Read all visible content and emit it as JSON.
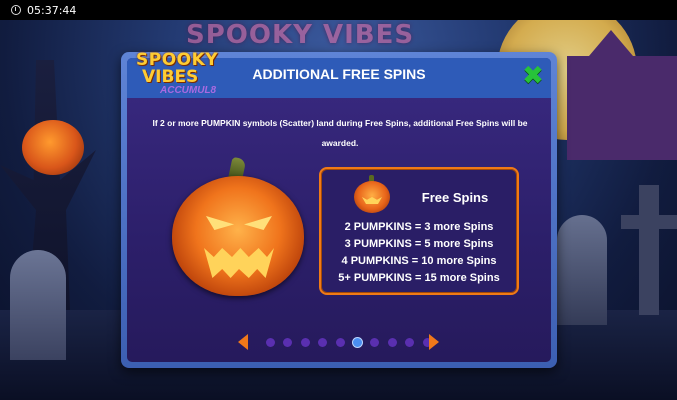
{
  "status_bar": {
    "time": "05:37:44"
  },
  "background": {
    "game_title": "SPOOKY VIBES"
  },
  "logo": {
    "line1": "SPOOKY",
    "line2": "VIBES",
    "line3": "ACCUMUL8"
  },
  "modal": {
    "title": "ADDITIONAL FREE SPINS",
    "close_symbol": "✖",
    "description": "If 2 or more PUMPKIN symbols (Scatter) land during Free Spins, additional Free Spins will be awarded."
  },
  "free_spins_box": {
    "title": "Free Spins",
    "rules": [
      "2 PUMPKINS = 3 more Spins",
      "3 PUMPKINS = 5 more Spins",
      "4 PUMPKINS = 10 more Spins",
      "5+ PUMPKINS = 15 more Spins"
    ]
  },
  "pagination": {
    "total_pages": 10,
    "current_page": 6
  },
  "colors": {
    "accent_orange": "#f07a16",
    "close_green": "#27c23a",
    "dot_active": "#4a8ef0",
    "dot_inactive": "#5a2fb0"
  }
}
